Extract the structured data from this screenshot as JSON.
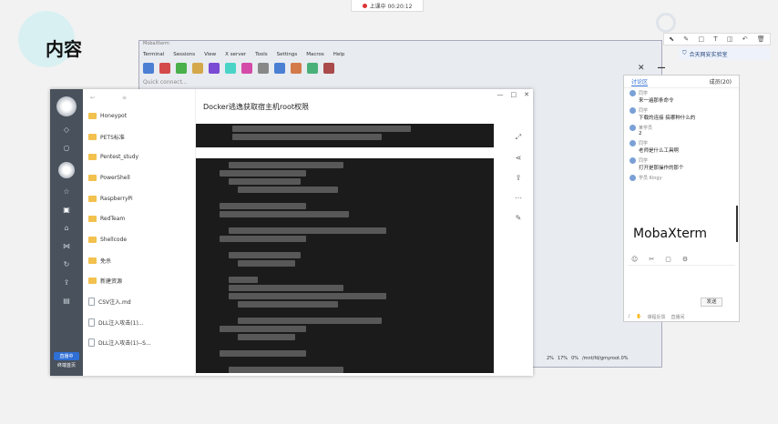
{
  "recording": {
    "label": "上课中 00:20:12"
  },
  "slide": {
    "title": "内容"
  },
  "moba": {
    "title": "MobaXterm",
    "menu": [
      "Terminal",
      "Sessions",
      "View",
      "X server",
      "Tools",
      "Settings",
      "Macros",
      "Help"
    ],
    "quick_connect_placeholder": "Quick connect...",
    "status": [
      "2%",
      "17%",
      "0%",
      "/mnt/fd/gmyroot.0%"
    ]
  },
  "app": {
    "sidebar_badge": "直播中",
    "sidebar_label": "终端首页",
    "files": [
      {
        "name": "Honeypot",
        "type": "folder"
      },
      {
        "name": "PETS标准",
        "type": "folder"
      },
      {
        "name": "Pentest_study",
        "type": "folder"
      },
      {
        "name": "PowerShell",
        "type": "folder"
      },
      {
        "name": "RaspberryPi",
        "type": "folder"
      },
      {
        "name": "RedTeam",
        "type": "folder"
      },
      {
        "name": "Shellcode",
        "type": "folder"
      },
      {
        "name": "免杀",
        "type": "folder"
      },
      {
        "name": "新建资源",
        "type": "folder"
      },
      {
        "name": "CSV注入.md",
        "type": "doc"
      },
      {
        "name": "DLL注入攻击(1)...",
        "type": "doc"
      },
      {
        "name": "DLL注入攻击(1)--S...",
        "type": "doc"
      }
    ],
    "doc_title": "Docker逃逸获取宿主机root权限"
  },
  "chat": {
    "tabs": [
      "讨论区",
      "成员(20)"
    ],
    "messages": [
      {
        "user": "同学",
        "text": "来一遍那条命令"
      },
      {
        "user": "同学",
        "text": "下载的连接 搞哪种什么的"
      },
      {
        "user": "某学员",
        "text": "2"
      },
      {
        "user": "同学",
        "text": "老师是什么工具啊"
      },
      {
        "user": "同学",
        "text": "打开是那操作的那个"
      },
      {
        "user": "学员 Kingy",
        "text": ""
      }
    ],
    "overlay": "MobaXterm",
    "send_label": "发送",
    "footer": [
      "课程反馈",
      "直播间"
    ]
  },
  "brand": {
    "label": "合天网安实验室"
  }
}
